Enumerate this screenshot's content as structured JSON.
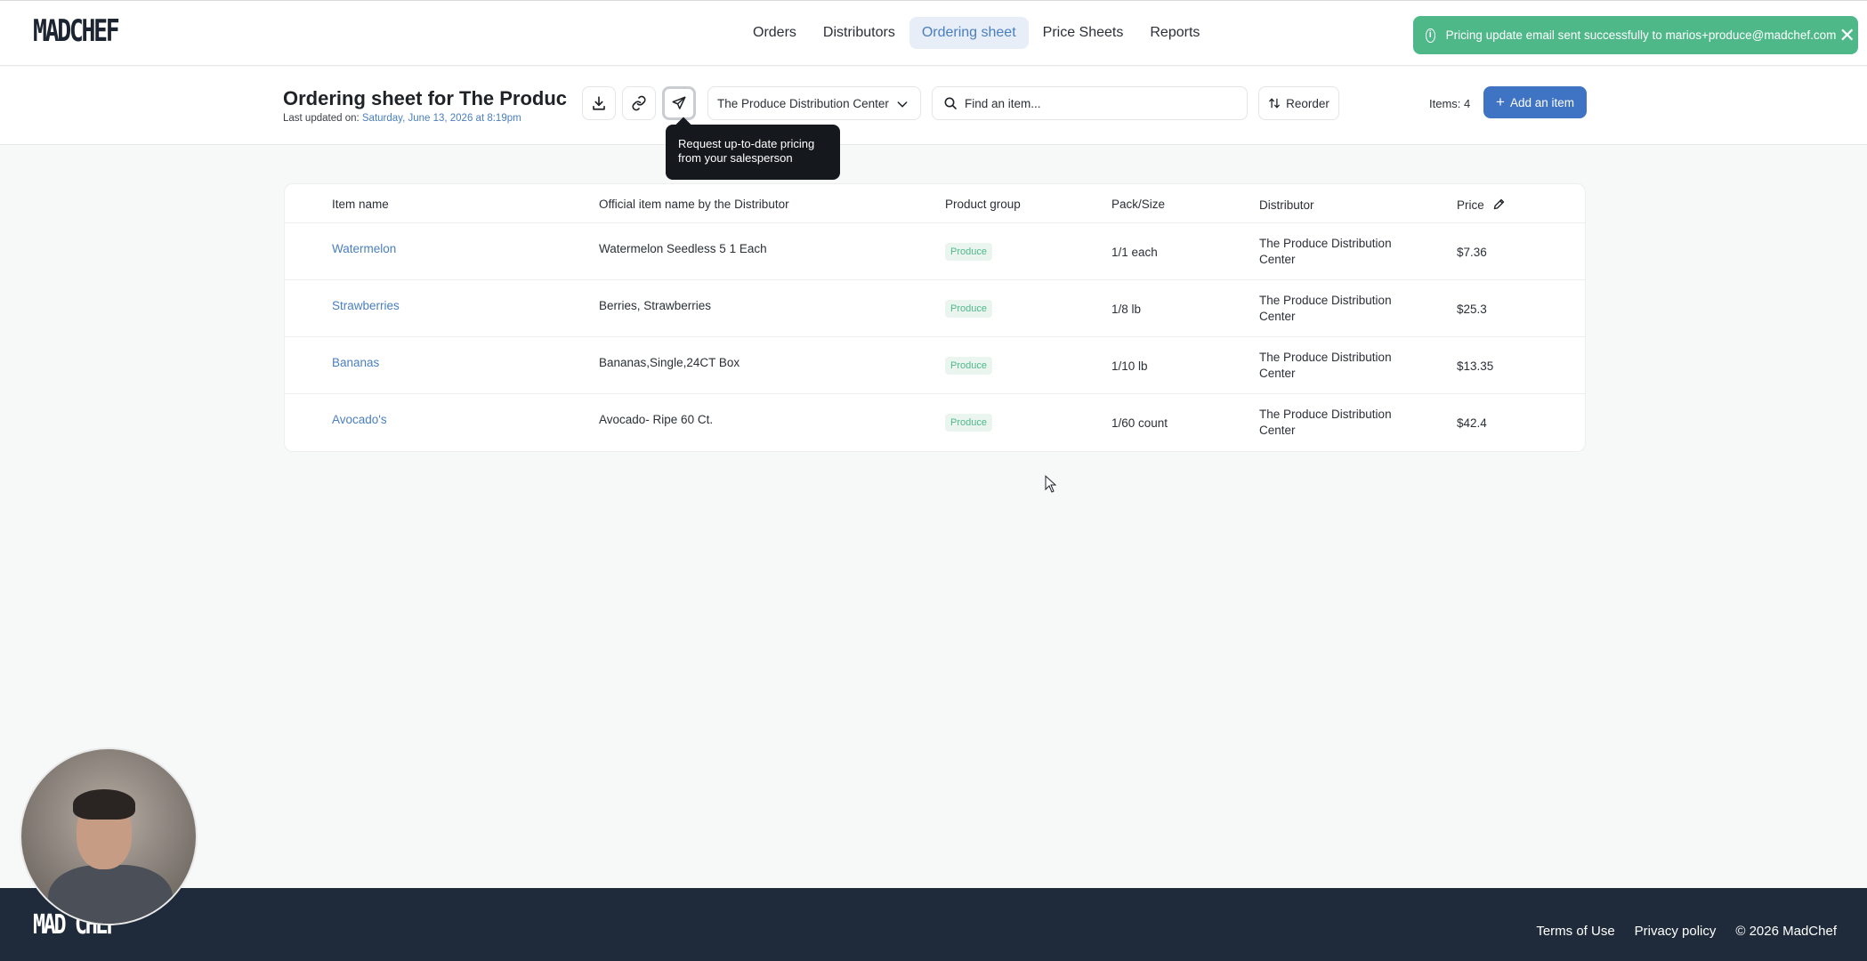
{
  "header": {
    "logo": "MADCHEF",
    "nav": [
      {
        "label": "Orders",
        "active": false
      },
      {
        "label": "Distributors",
        "active": false
      },
      {
        "label": "Ordering sheet",
        "active": true
      },
      {
        "label": "Price Sheets",
        "active": false
      },
      {
        "label": "Reports",
        "active": false
      }
    ],
    "toast": {
      "message": "Pricing update email sent successfully to marios+produce@madchef.com",
      "icon": "info-icon",
      "close_icon": "close-icon",
      "color": "#4fb889"
    }
  },
  "toolbar": {
    "title": "Ordering sheet  for The Produc...",
    "last_updated_label": "Last updated on: ",
    "last_updated_value": "Saturday, June 13, 2026 at 8:19pm",
    "distributor_select": "The Produce Distribution Center",
    "search_placeholder": "Find an item...",
    "reorder_label": "Reorder",
    "items_count": "Items: 4",
    "add_label": "Add an item",
    "tooltip": "Request up-to-date pricing from your salesperson",
    "accent": "#3f73c4"
  },
  "table": {
    "headers": {
      "name": "Item name",
      "official": "Official item name by the Distributor",
      "group": "Product group",
      "pack": "Pack/Size",
      "distributor": "Distributor",
      "price": "Price"
    },
    "rows": [
      {
        "name": "Watermelon",
        "official": "Watermelon Seedless 5 1 Each",
        "group": "Produce",
        "pack": "1/1 each",
        "distributor": "The Produce Distribution Center",
        "price": "$7.36"
      },
      {
        "name": "Strawberries",
        "official": "Berries, Strawberries",
        "group": "Produce",
        "pack": "1/8 lb",
        "distributor": "The Produce Distribution Center",
        "price": "$25.3"
      },
      {
        "name": "Bananas",
        "official": "Bananas,Single,24CT Box",
        "group": "Produce",
        "pack": "1/10 lb",
        "distributor": "The Produce Distribution Center",
        "price": "$13.35"
      },
      {
        "name": "Avocado's",
        "official": "Avocado- Ripe 60 Ct.",
        "group": "Produce",
        "pack": "1/60 count",
        "distributor": "The Produce Distribution Center",
        "price": "$42.4"
      }
    ]
  },
  "footer": {
    "logo": "MAD CHEF",
    "links": [
      "Terms of Use",
      "Privacy policy",
      "© 2026 MadChef"
    ]
  }
}
